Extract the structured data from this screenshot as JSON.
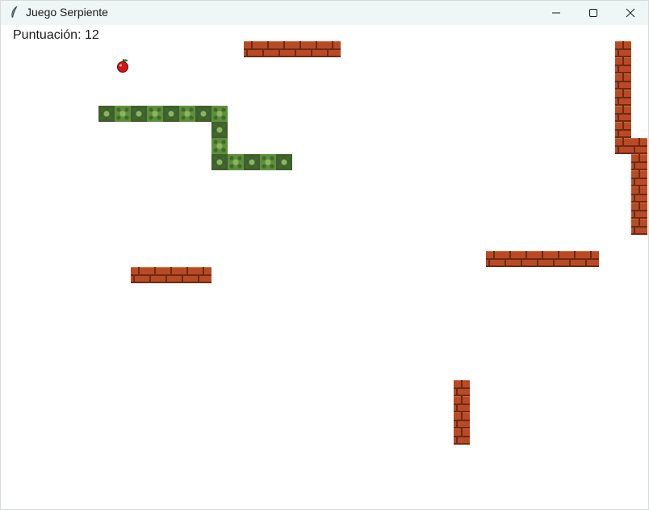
{
  "window": {
    "title": "Juego Serpiente",
    "icon": "feather-icon",
    "controls": [
      "minimize-icon",
      "maximize-icon",
      "close-icon"
    ]
  },
  "game": {
    "score_text": "Puntuación: 12",
    "score": 12,
    "colors": {
      "wall": "#b84a26",
      "snake": "#5f8f3c",
      "apple": "#d01818",
      "background": "#ffffff"
    },
    "food": {
      "col": 7,
      "row": 2,
      "icon": "apple-icon"
    },
    "snake": [
      [
        6,
        5
      ],
      [
        7,
        5
      ],
      [
        8,
        5
      ],
      [
        9,
        5
      ],
      [
        10,
        5
      ],
      [
        11,
        5
      ],
      [
        12,
        5
      ],
      [
        13,
        5
      ],
      [
        13,
        6
      ],
      [
        13,
        7
      ],
      [
        13,
        8
      ],
      [
        14,
        8
      ],
      [
        15,
        8
      ],
      [
        16,
        8
      ],
      [
        17,
        8
      ]
    ],
    "walls": [
      [
        15,
        1
      ],
      [
        16,
        1
      ],
      [
        17,
        1
      ],
      [
        18,
        1
      ],
      [
        19,
        1
      ],
      [
        20,
        1
      ],
      [
        38,
        1
      ],
      [
        38,
        2
      ],
      [
        38,
        3
      ],
      [
        38,
        4
      ],
      [
        38,
        5
      ],
      [
        38,
        6
      ],
      [
        38,
        7
      ],
      [
        39,
        7
      ],
      [
        39,
        8
      ],
      [
        39,
        9
      ],
      [
        39,
        10
      ],
      [
        39,
        11
      ],
      [
        39,
        12
      ],
      [
        30,
        14
      ],
      [
        31,
        14
      ],
      [
        32,
        14
      ],
      [
        33,
        14
      ],
      [
        34,
        14
      ],
      [
        35,
        14
      ],
      [
        36,
        14
      ],
      [
        8,
        15
      ],
      [
        9,
        15
      ],
      [
        10,
        15
      ],
      [
        11,
        15
      ],
      [
        12,
        15
      ],
      [
        28,
        22
      ],
      [
        28,
        23
      ],
      [
        28,
        24
      ],
      [
        28,
        25
      ]
    ]
  }
}
